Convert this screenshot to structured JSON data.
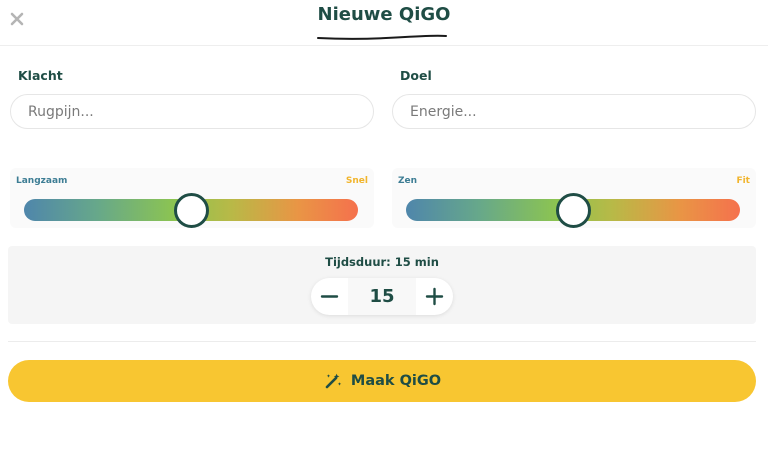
{
  "header": {
    "close_icon": "close-icon",
    "title": "Nieuwe QiGO"
  },
  "complaint": {
    "label": "Klacht",
    "placeholder": "Rugpijn...",
    "value": ""
  },
  "goal": {
    "label": "Doel",
    "placeholder": "Energie...",
    "value": ""
  },
  "speed_slider": {
    "left_label": "Langzaam",
    "right_label": "Snel",
    "level_fraction": 0.5
  },
  "mood_slider": {
    "left_label": "Zen",
    "right_label": "Fit",
    "level_fraction": 0.5
  },
  "duration": {
    "label": "Tijdsduur: 15 min",
    "value": "15",
    "decrease_icon": "minus-icon",
    "increase_icon": "plus-icon"
  },
  "submit": {
    "icon": "magic-wand-icon",
    "label": "Maak QiGO"
  },
  "colors": {
    "primary_text": "#1f4d45",
    "accent_yellow": "#f8c631",
    "slider_left_label": "#3d7d94",
    "slider_right_label": "#f1b52d"
  }
}
